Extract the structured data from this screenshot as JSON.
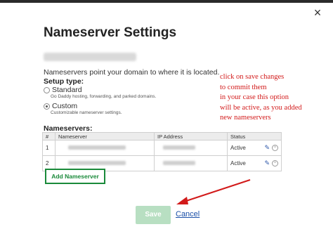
{
  "dialog": {
    "title": "Nameserver Settings",
    "close_glyph": "×",
    "description": "Nameservers point your domain to where it is located.",
    "setup_type_label": "Setup type:",
    "options": [
      {
        "label": "Standard",
        "sub": "Go Daddy hosting, forwarding, and parked domains.",
        "selected": false
      },
      {
        "label": "Custom",
        "sub": "Customizable nameserver settings.",
        "selected": true
      }
    ],
    "nameservers_label": "Nameservers:",
    "table": {
      "headers": [
        "#",
        "Nameserver",
        "IP Address",
        "Status"
      ],
      "rows": [
        {
          "num": "1",
          "status": "Active"
        },
        {
          "num": "2",
          "status": "Active"
        }
      ]
    },
    "add_button": "Add Nameserver",
    "save_button": "Save",
    "cancel_link": "Cancel"
  },
  "annotation": {
    "lines": [
      "click on save changes",
      "to commit them",
      "in your case this option",
      "will be active, as you added",
      "new nameservers"
    ],
    "color": "#d21a1a"
  },
  "colors": {
    "accent_green": "#1a8a3a",
    "save_disabled": "#b8dfc2",
    "link_blue": "#1a4fa8"
  }
}
